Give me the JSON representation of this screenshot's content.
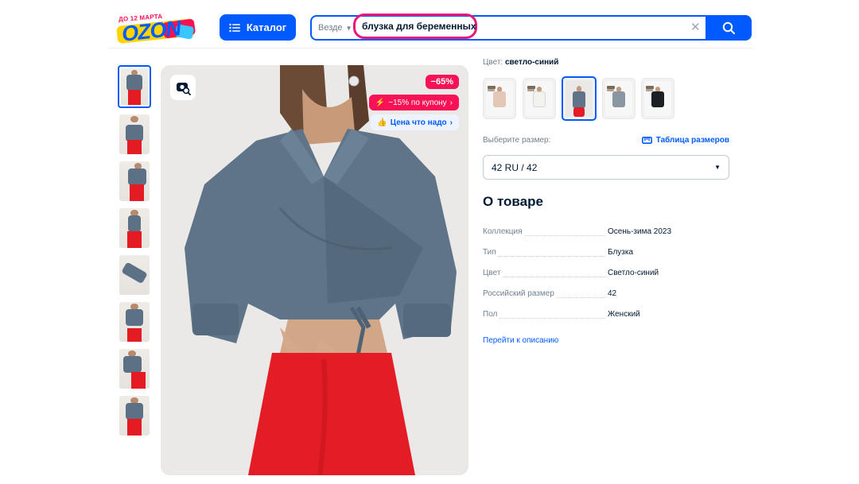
{
  "header": {
    "logo": {
      "promo": "ДО 12 МАРТА",
      "word": "OZON"
    },
    "catalog_label": "Каталог",
    "search": {
      "scope": "Везде",
      "query": "блузка для беременных"
    }
  },
  "product": {
    "badges": {
      "discount": "−65%",
      "coupon": "−15% по купону",
      "price_tag": "Цена что надо"
    },
    "color_label": "Цвет:",
    "color_value": "светло-синий",
    "size_prompt": "Выберите размер:",
    "size_table_link": "Таблица размеров",
    "selected_size": "42 RU / 42",
    "about_title": "О товаре",
    "specs": [
      {
        "key": "Коллекция",
        "value": "Осень-зима 2023"
      },
      {
        "key": "Тип",
        "value": "Блузка"
      },
      {
        "key": "Цвет",
        "value": "Светло-синий"
      },
      {
        "key": "Российский размер",
        "value": "42"
      },
      {
        "key": "Пол",
        "value": "Женский"
      }
    ],
    "description_link": "Перейти к описанию"
  },
  "colors": {
    "brand_blue": "#005bff",
    "accent_pink": "#f91155",
    "highlight_ring": "#e6197d"
  }
}
